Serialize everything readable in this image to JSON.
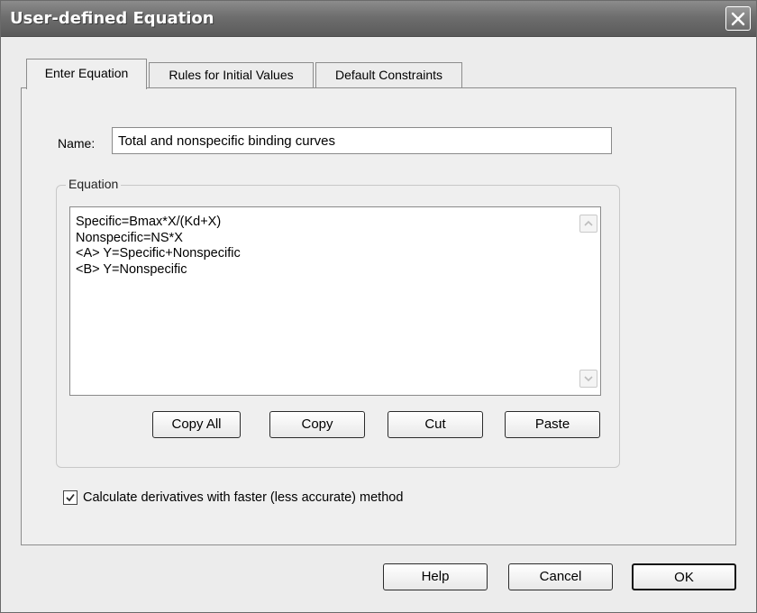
{
  "window": {
    "title": "User-defined Equation"
  },
  "tabs": [
    {
      "label": "Enter Equation",
      "active": true
    },
    {
      "label": "Rules for Initial Values",
      "active": false
    },
    {
      "label": "Default Constraints",
      "active": false
    }
  ],
  "name_field": {
    "label": "Name:",
    "value": "Total and nonspecific binding curves"
  },
  "equation_group": {
    "legend": "Equation",
    "lines": [
      "Specific=Bmax*X/(Kd+X)",
      "Nonspecific=NS*X",
      "<A> Y=Specific+Nonspecific",
      "<B> Y=Nonspecific"
    ],
    "buttons": {
      "copy_all": "Copy All",
      "copy": "Copy",
      "cut": "Cut",
      "paste": "Paste"
    }
  },
  "checkbox": {
    "label": "Calculate derivatives with faster (less accurate) method",
    "checked": true
  },
  "footer_buttons": {
    "help": "Help",
    "cancel": "Cancel",
    "ok": "OK"
  },
  "colors": {
    "titlebar": "#6e6e6e",
    "dialog_bg": "#ececec",
    "panel_bg": "#efefef"
  }
}
